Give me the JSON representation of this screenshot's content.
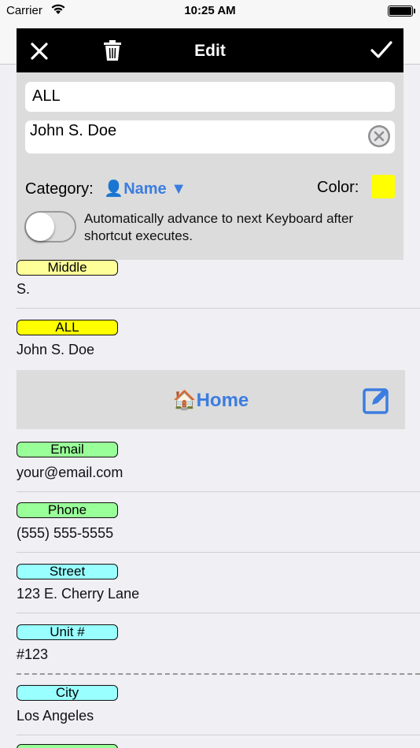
{
  "status_bar": {
    "carrier": "Carrier",
    "time": "10:25 AM"
  },
  "edit_panel": {
    "title": "Edit",
    "shortcut_value": "ALL",
    "text_value": "John S. Doe",
    "category_label": "Category:",
    "category_icon": "👤",
    "category_value": "Name",
    "category_arrow": "▼",
    "color_label": "Color:",
    "color_value": "#ffff00",
    "toggle_on": false,
    "toggle_label": "Automatically advance to next Keyboard after shortcut executes."
  },
  "rows_top": [
    {
      "tag": "Middle",
      "value": "S.",
      "color": "#ffff99"
    },
    {
      "tag": "ALL",
      "value": "John S. Doe",
      "color": "#ffff00"
    }
  ],
  "section": {
    "icon": "🏠",
    "title": "Home"
  },
  "rows_home": [
    {
      "tag": "Email",
      "value": "your@email.com",
      "color": "#99ff99"
    },
    {
      "tag": "Phone",
      "value": "(555) 555-5555",
      "color": "#99ff99"
    },
    {
      "tag": "Street",
      "value": "123 E. Cherry Lane",
      "color": "#99ffff"
    },
    {
      "tag": "Unit #",
      "value": "#123",
      "color": "#99ffff"
    },
    {
      "tag": "City",
      "value": "Los Angeles",
      "color": "#99ffff"
    }
  ],
  "icons": {
    "close": "close-icon",
    "trash": "trash-icon",
    "done": "checkmark-icon",
    "clear": "clear-circle-icon",
    "wifi": "wifi-icon",
    "battery": "battery-icon",
    "edit": "edit-square-icon"
  }
}
